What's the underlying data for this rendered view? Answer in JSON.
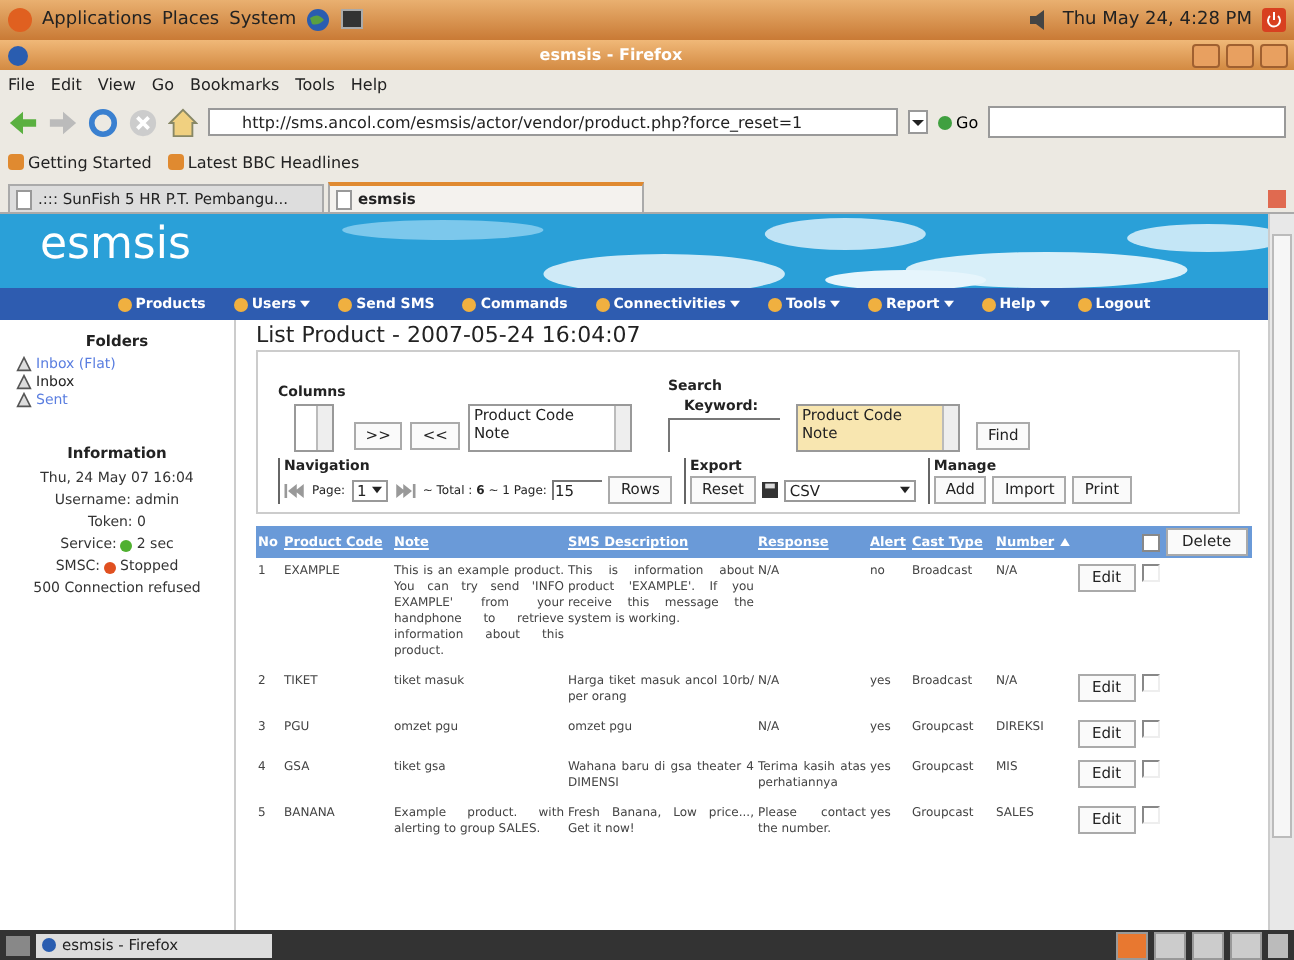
{
  "top_panel": {
    "menus": [
      "Applications",
      "Places",
      "System"
    ],
    "clock": "Thu May 24,  4:28 PM"
  },
  "window": {
    "title": "esmsis - Firefox"
  },
  "menu": [
    "File",
    "Edit",
    "View",
    "Go",
    "Bookmarks",
    "Tools",
    "Help"
  ],
  "toolbar": {
    "url": "http://sms.ancol.com/esmsis/actor/vendor/product.php?force_reset=1",
    "go": "Go"
  },
  "bookmarks": [
    "Getting Started",
    "Latest BBC Headlines"
  ],
  "tabs": [
    {
      "label": ".::: SunFish 5 HR P.T. Pembangu...",
      "selected": false
    },
    {
      "label": "esmsis",
      "selected": true
    }
  ],
  "site": {
    "logo": "esmsis",
    "nav": [
      {
        "label": "Products",
        "dropdown": false
      },
      {
        "label": "Users",
        "dropdown": true
      },
      {
        "label": "Send SMS",
        "dropdown": false
      },
      {
        "label": "Commands",
        "dropdown": false
      },
      {
        "label": "Connectivities",
        "dropdown": true
      },
      {
        "label": "Tools",
        "dropdown": true
      },
      {
        "label": "Report",
        "dropdown": true
      },
      {
        "label": "Help",
        "dropdown": true
      },
      {
        "label": "Logout",
        "dropdown": false
      }
    ]
  },
  "sidebar": {
    "folders_title": "Folders",
    "folders": [
      {
        "label": "Inbox (Flat)",
        "link": true
      },
      {
        "label": "Inbox",
        "link": false
      },
      {
        "label": "Sent",
        "link": true
      }
    ],
    "info_title": "Information",
    "info": [
      "Thu, 24 May 07 16:04",
      "Username: admin",
      "Token: 0"
    ],
    "status": [
      {
        "label": "Service:",
        "value": "2 sec",
        "color": "#50b030"
      },
      {
        "label": "SMSC:",
        "value": "Stopped",
        "color": "#e05020"
      }
    ],
    "error": "500 Connection refused"
  },
  "main": {
    "title": "List Product - 2007-05-24 16:04:07",
    "columns": {
      "label": "Columns",
      "add": ">>",
      "remove": "<<",
      "options": [
        "Product Code",
        "Note"
      ]
    },
    "search": {
      "label": "Search",
      "keyword": "Keyword:",
      "options": [
        "Product Code",
        "Note"
      ],
      "find": "Find"
    },
    "navigation": {
      "label": "Navigation",
      "page_label": "Page:",
      "page": "1",
      "total": "~ Total : **6** ~ 1 Page:",
      "rows": "15",
      "rows_button": "Rows"
    },
    "export": {
      "label": "Export",
      "reset": "Reset",
      "format": "CSV"
    },
    "manage": {
      "label": "Manage",
      "buttons": [
        "Add",
        "Import",
        "Print"
      ]
    }
  },
  "table": {
    "columns": [
      {
        "label": "No",
        "link": false,
        "sorted": false
      },
      {
        "label": "Product Code",
        "link": true,
        "sorted": false
      },
      {
        "label": "Note",
        "link": true,
        "sorted": false
      },
      {
        "label": "SMS Description",
        "link": true,
        "sorted": false
      },
      {
        "label": "Response",
        "link": true,
        "sorted": false
      },
      {
        "label": "Alert",
        "link": true,
        "sorted": false
      },
      {
        "label": "Cast Type",
        "link": true,
        "sorted": false
      },
      {
        "label": "Number",
        "link": true,
        "sorted": true
      }
    ],
    "all_checked": false,
    "delete": "Delete",
    "rows": [
      {
        "cells": [
          "1",
          "EXAMPLE",
          "This is an example product. You can try send 'INFO EXAMPLE' from your handphone to retrieve information about this product.",
          "This is information about product 'EXAMPLE'. If you receive this message the system is working.",
          "N/A",
          "no",
          "Broadcast",
          "N/A"
        ],
        "edit": "Edit",
        "checked": false
      },
      {
        "cells": [
          "2",
          "TIKET",
          "tiket masuk",
          "Harga tiket masuk ancol 10rb/ per orang",
          "N/A",
          "yes",
          "Broadcast",
          "N/A"
        ],
        "edit": "Edit",
        "checked": false
      },
      {
        "cells": [
          "3",
          "PGU",
          "omzet pgu",
          "omzet pgu",
          "N/A",
          "yes",
          "Groupcast",
          "DIREKSI"
        ],
        "edit": "Edit",
        "checked": false
      },
      {
        "cells": [
          "4",
          "GSA",
          "tiket gsa",
          "Wahana baru di gsa theater 4 DIMENSI",
          "Terima kasih atas perhatiannya",
          "yes",
          "Groupcast",
          "MIS"
        ],
        "edit": "Edit",
        "checked": false
      },
      {
        "cells": [
          "5",
          "BANANA",
          "Example product. with alerting to group SALES.",
          "Fresh Banana, Low price..., Get it now!",
          "Please contact the number.",
          "yes",
          "Groupcast",
          "SALES"
        ],
        "edit": "Edit",
        "checked": false
      }
    ]
  },
  "taskbar": {
    "window": "esmsis - Firefox"
  }
}
